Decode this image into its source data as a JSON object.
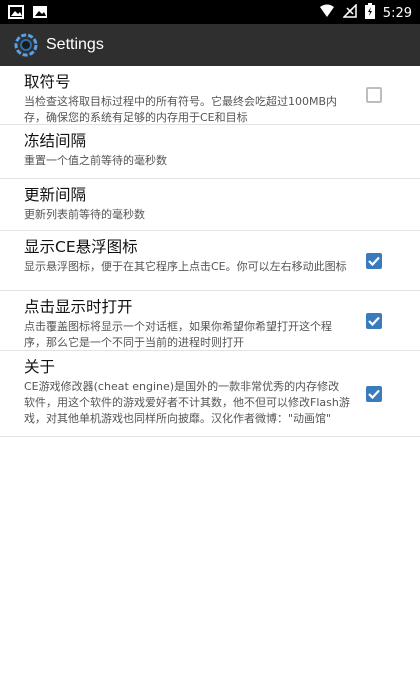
{
  "status_bar": {
    "time": "5:29",
    "icons": [
      "image-icon",
      "gallery-icon",
      "wifi-icon",
      "signal-icon",
      "battery-icon"
    ]
  },
  "app_bar": {
    "title": "Settings",
    "logo_icon": "cheat-engine-logo-icon"
  },
  "settings": [
    {
      "title": "取符号",
      "description": "当检查这将取目标过程中的所有符号。它最终会吃超过100MB内存，确保您的系统有足够的内存用于CE和目标",
      "checked": false
    },
    {
      "title": "冻结间隔",
      "description": "重置一个值之前等待的毫秒数",
      "checked": null
    },
    {
      "title": "更新间隔",
      "description": "更新列表前等待的毫秒数",
      "checked": null
    },
    {
      "title": "显示CE悬浮图标",
      "description": "显示悬浮图标，便于在其它程序上点击CE。你可以左右移动此图标",
      "checked": true
    },
    {
      "title": "点击显示时打开",
      "description": "点击覆盖图标将显示一个对话框，如果你希望你希望打开这个程序，那么它是一个不同于当前的进程时则打开",
      "checked": true
    },
    {
      "title": "关于",
      "description": "CE游戏修改器(cheat engine)是国外的一款非常优秀的内存修改软件，用这个软件的游戏爱好者不计其数，他不但可以修改Flash游戏，对其他单机游戏也同样所向披靡。汉化作者微博：\"动画馆\"",
      "checked": true
    }
  ],
  "colors": {
    "status_bar": "#000000",
    "app_bar": "#2f2f2f",
    "checkbox_on": "#3a7bbd",
    "checkbox_off_border": "#bdbdbd"
  }
}
